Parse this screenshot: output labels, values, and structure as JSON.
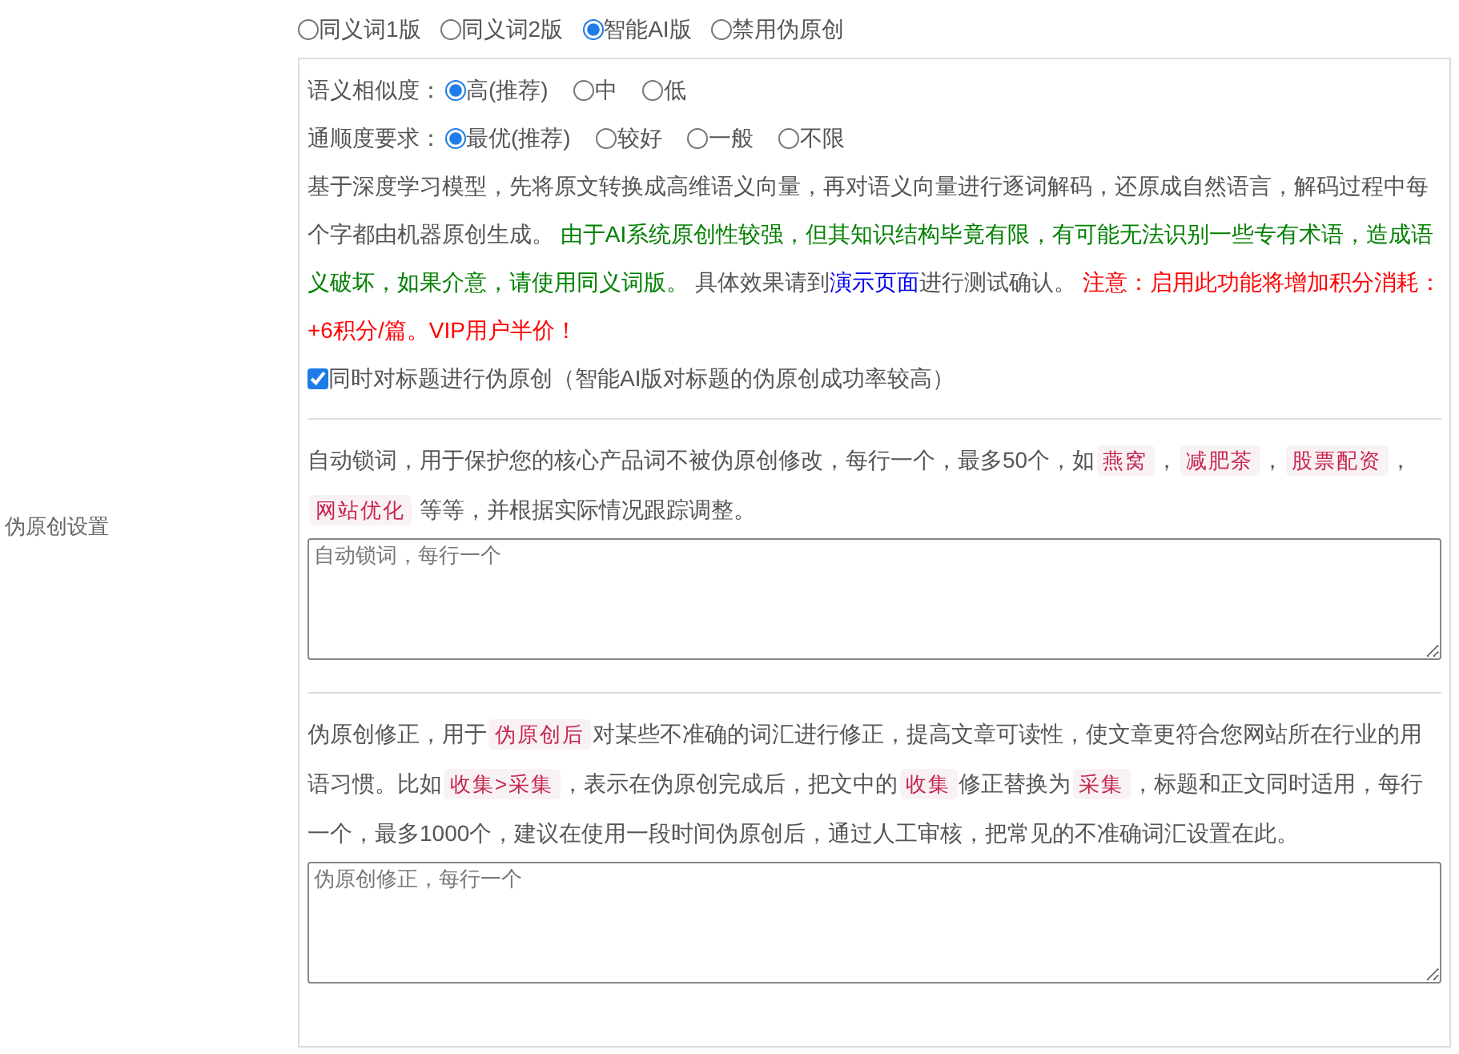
{
  "section_label": "伪原创设置",
  "mode_options": [
    {
      "label": "同义词1版",
      "selected": false
    },
    {
      "label": "同义词2版",
      "selected": false
    },
    {
      "label": "智能AI版",
      "selected": true
    },
    {
      "label": "禁用伪原创",
      "selected": false
    }
  ],
  "similarity": {
    "label": "语义相似度：",
    "options": [
      {
        "label": "高(推荐)",
        "selected": true
      },
      {
        "label": "中",
        "selected": false
      },
      {
        "label": "低",
        "selected": false
      }
    ]
  },
  "fluency": {
    "label": "通顺度要求：",
    "options": [
      {
        "label": "最优(推荐)",
        "selected": true
      },
      {
        "label": "较好",
        "selected": false
      },
      {
        "label": "一般",
        "selected": false
      },
      {
        "label": "不限",
        "selected": false
      }
    ]
  },
  "description": [
    {
      "kind": "text",
      "text": "基于深度学习模型，先将原文转换成高维语义向量，再对语义向量进行逐词解码，还原成自然语言，解码过程中每个字都由机器原创生成。 "
    },
    {
      "kind": "note",
      "text": "由于AI系统原创性较强，但其知识结构毕竟有限，有可能无法识别一些专有术语，造成语义破坏，如果介意，请使用同义词版。"
    },
    {
      "kind": "text",
      "text": " 具体效果请到"
    },
    {
      "kind": "link",
      "text": "演示页面"
    },
    {
      "kind": "text",
      "text": "进行测试确认。 "
    },
    {
      "kind": "warning",
      "text": "注意：启用此功能将增加积分消耗：+6积分/篇。VIP用户半价！"
    }
  ],
  "title_checkbox": {
    "label": "同时对标题进行伪原创（智能AI版对标题的伪原创成功率较高）",
    "checked": true
  },
  "lock_words": {
    "description": [
      {
        "kind": "text",
        "text": "自动锁词，用于保护您的核心产品词不被伪原创修改，每行一个，最多50个，如"
      },
      {
        "kind": "tag",
        "text": "燕窝"
      },
      {
        "kind": "text",
        "text": "，"
      },
      {
        "kind": "tag",
        "text": "减肥茶"
      },
      {
        "kind": "text",
        "text": "，"
      },
      {
        "kind": "tag",
        "text": "股票配资"
      },
      {
        "kind": "text",
        "text": "，"
      },
      {
        "kind": "tag",
        "text": "网站优化"
      },
      {
        "kind": "text",
        "text": " 等等，并根据实际情况跟踪调整。"
      }
    ],
    "placeholder": "自动锁词，每行一个"
  },
  "correction": {
    "description": [
      {
        "kind": "text",
        "text": "伪原创修正，用于"
      },
      {
        "kind": "tag",
        "text": "伪原创后"
      },
      {
        "kind": "text",
        "text": "对某些不准确的词汇进行修正，提高文章可读性，使文章更符合您网站所在行业的用语习惯。比如"
      },
      {
        "kind": "tag",
        "text": "收集>采集"
      },
      {
        "kind": "text",
        "text": "，表示在伪原创完成后，把文中的"
      },
      {
        "kind": "tag",
        "text": "收集"
      },
      {
        "kind": "text",
        "text": "修正替换为"
      },
      {
        "kind": "tag",
        "text": "采集"
      },
      {
        "kind": "text",
        "text": "，标题和正文同时适用，每行一个，最多1000个，建议在使用一段时间伪原创后，通过人工审核，把常见的不准确词汇设置在此。"
      }
    ],
    "placeholder": "伪原创修正，每行一个"
  }
}
